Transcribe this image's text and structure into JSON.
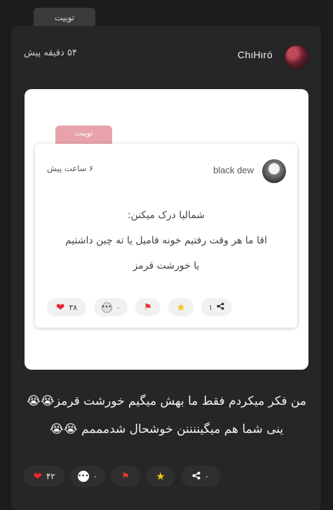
{
  "outer_tab": {
    "label": "توییت"
  },
  "post": {
    "author": "ChιHιró",
    "time": "۵۴ دقیقه پیش",
    "text_lines": [
      "من فکر میکردم فقط ما بهش میگیم خورشت قرمز😭😭",
      "ینی شما هم میگیننننن خوشحال شدمممم 😭😭"
    ],
    "actions": {
      "likes": "۴۲",
      "comments": "۰",
      "share": "۰"
    }
  },
  "embed": {
    "tab_label": "توییت",
    "author": "black dew",
    "time": "۶ ساعت پیش",
    "text_lines": [
      "شمالیا درک میکنن:",
      "اقا ما هر وقت رفتیم خونه فامیل یا ته چین داشتیم",
      "یا خورشت قرمز"
    ],
    "actions": {
      "share": "۱",
      "comments": "۰",
      "likes": "۳۸"
    }
  },
  "icons": {
    "heart": "heart-icon",
    "comment": "comment-icon",
    "flag": "flag-icon",
    "star": "star-icon",
    "share": "share-icon"
  },
  "colors": {
    "background": "#1c1c1c",
    "card": "#262626",
    "heart": "#e8262f",
    "star": "#f0c419",
    "tab_pink": "#e8a3aa"
  }
}
